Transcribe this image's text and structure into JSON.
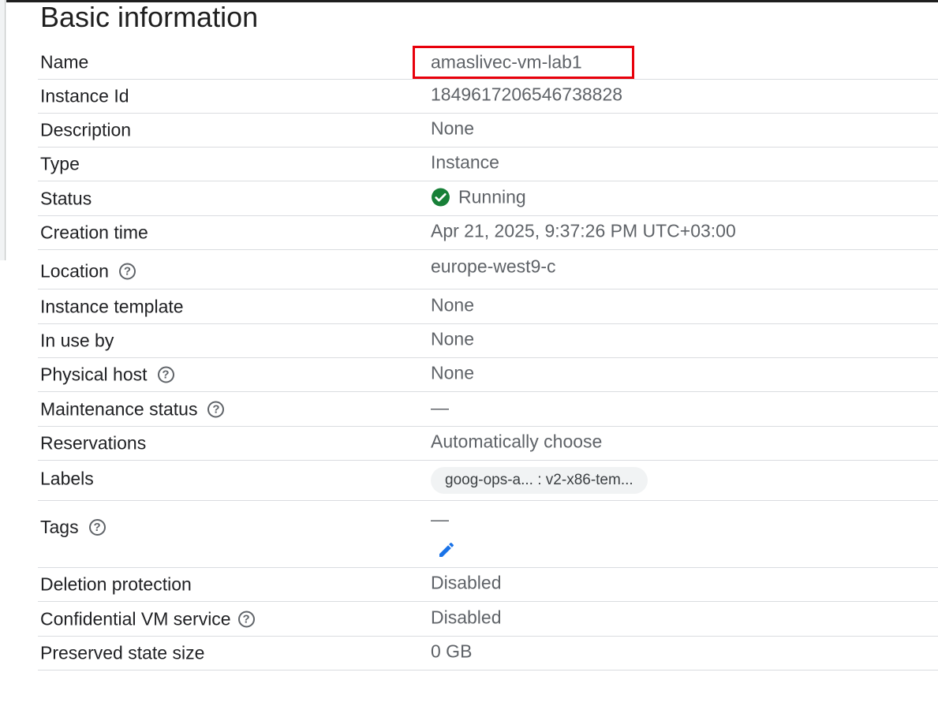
{
  "section": {
    "title": "Basic information"
  },
  "rows": [
    {
      "label": "Name",
      "value": "amaslivec-vm-lab1"
    },
    {
      "label": "Instance Id",
      "value": "1849617206546738828"
    },
    {
      "label": "Description",
      "value": "None"
    },
    {
      "label": "Type",
      "value": "Instance"
    },
    {
      "label": "Status",
      "value": "Running"
    },
    {
      "label": "Creation time",
      "value": "Apr 21, 2025, 9:37:26 PM UTC+03:00"
    },
    {
      "label": "Location",
      "value": "europe-west9-c"
    },
    {
      "label": "Instance template",
      "value": "None"
    },
    {
      "label": "In use by",
      "value": "None"
    },
    {
      "label": "Physical host",
      "value": "None"
    },
    {
      "label": "Maintenance status",
      "value": "—"
    },
    {
      "label": "Reservations",
      "value": "Automatically choose"
    },
    {
      "label": "Labels",
      "value": "goog-ops-a... : v2-x86-tem..."
    },
    {
      "label": "Tags",
      "value": "—"
    },
    {
      "label": "Deletion protection",
      "value": "Disabled"
    },
    {
      "label": "Confidential VM service",
      "value": "Disabled"
    },
    {
      "label": "Preserved state size",
      "value": "0 GB"
    }
  ],
  "icons": {
    "help": "?",
    "status": "check-circle-icon",
    "edit": "pencil-icon"
  },
  "colors": {
    "status_green": "#188038",
    "highlight_red": "#e8000b",
    "edit_blue": "#1a73e8"
  }
}
